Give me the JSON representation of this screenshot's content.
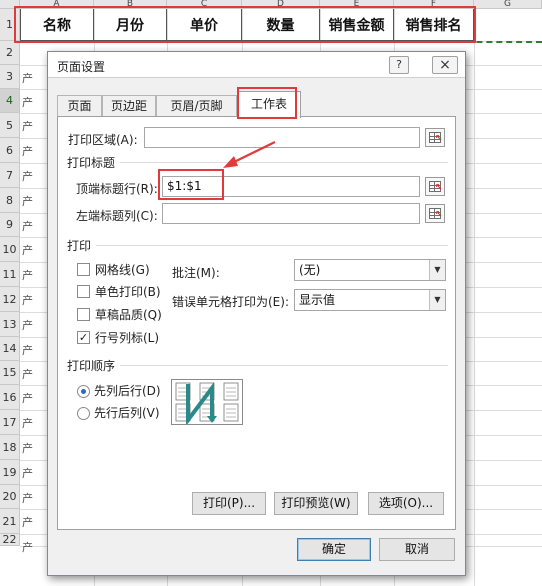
{
  "sheet": {
    "columns": [
      "A",
      "B",
      "C",
      "D",
      "E",
      "F",
      "G"
    ],
    "rows": [
      "1",
      "2",
      "3",
      "4",
      "5",
      "6",
      "7",
      "8",
      "9",
      "10",
      "11",
      "12",
      "13",
      "14",
      "15",
      "16",
      "17",
      "18",
      "19",
      "20",
      "21",
      "22"
    ],
    "header_row": [
      "名称",
      "月份",
      "单价",
      "数量",
      "销售金额",
      "销售排名"
    ],
    "row_bits": [
      "产",
      "产",
      "产",
      "产",
      "产",
      "产",
      "产",
      "产",
      "产",
      "产",
      "产",
      "产",
      "产",
      "产",
      "产",
      "产",
      "产",
      "产",
      "产",
      "产"
    ]
  },
  "dialog": {
    "title": "页面设置",
    "help": "?",
    "close": "×",
    "tabs": [
      {
        "label": "页面"
      },
      {
        "label": "页边距"
      },
      {
        "label": "页眉/页脚"
      },
      {
        "label": "工作表"
      }
    ],
    "print_area_label": "打印区域(A):",
    "print_area_value": "",
    "print_titles_section": "打印标题",
    "top_rows_label": "顶端标题行(R):",
    "top_rows_value": "$1:$1",
    "left_cols_label": "左端标题列(C):",
    "left_cols_value": "",
    "print_section": "打印",
    "checkboxes": [
      {
        "label": "网格线(G)",
        "checked": false
      },
      {
        "label": "单色打印(B)",
        "checked": false
      },
      {
        "label": "草稿品质(Q)",
        "checked": false
      },
      {
        "label": "行号列标(L)",
        "checked": true
      }
    ],
    "comments_label": "批注(M):",
    "comments_value": "(无)",
    "errors_label": "错误单元格打印为(E):",
    "errors_value": "显示值",
    "order_section": "打印顺序",
    "order_options": [
      {
        "label": "先列后行(D)",
        "selected": true
      },
      {
        "label": "先行后列(V)",
        "selected": false
      }
    ],
    "print_button": "打印(P)...",
    "preview_button": "打印预览(W)",
    "options_button": "选项(O)...",
    "ok_button": "确定",
    "cancel_button": "取消"
  },
  "colors": {
    "annotation_red": "#e03a3a",
    "marching_ants": "#2e7d32",
    "dialog_border": "#6f8ca8"
  }
}
